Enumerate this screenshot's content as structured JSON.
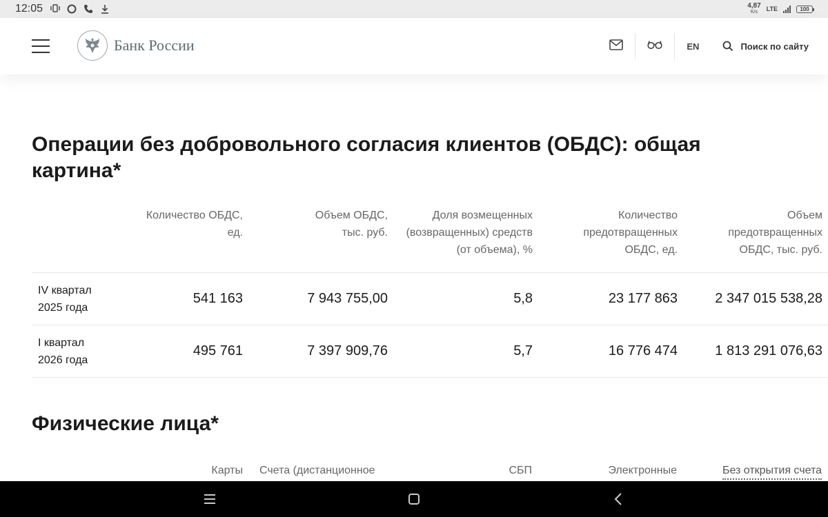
{
  "status_bar": {
    "time": "12:05",
    "net_speed": "4,87",
    "net_unit": "K/s",
    "network": "LTE",
    "battery": "100",
    "icons": [
      "vibrate-icon",
      "chat-icon",
      "call-icon",
      "download-icon",
      "signal-icon",
      "battery-icon"
    ]
  },
  "header": {
    "logo_name": "Банк России",
    "lang": "EN",
    "search_label": "Поиск по сайту",
    "icons": [
      "menu-icon",
      "emblem-icon",
      "mail-icon",
      "glasses-icon",
      "search-icon"
    ]
  },
  "main": {
    "title": "Операции без добровольного согласия клиентов (ОБДС): общая картина*",
    "table": {
      "columns": [
        "",
        "Количество ОБДС, ед.",
        "Объем ОБДС, тыс. руб.",
        "Доля возмещенных (возвращенных) средств (от объема), %",
        "Количество предотвращенных ОБДС, ед.",
        "Объем предотвращенных ОБДС, тыс. руб."
      ],
      "rows": [
        {
          "label": "IV квартал 2025 года",
          "values": [
            "541 163",
            "7 943 755,00",
            "5,8",
            "23 177 863",
            "2 347 015 538,28"
          ]
        },
        {
          "label": "I квартал 2026 года",
          "values": [
            "495 761",
            "7 397 909,76",
            "5,7",
            "16 776 474",
            "1 813 291 076,63"
          ]
        }
      ]
    },
    "section2_title": "Физические лица*",
    "section2_columns": [
      "Карты",
      "Счета (дистанционное",
      "СБП",
      "Электронные",
      "Без открытия счета"
    ]
  },
  "colors": {
    "status_bar_bg": "#ececec",
    "nav_bar_bg": "#000000",
    "text": "#1b1b1b",
    "muted": "#666666",
    "logo_text": "#5e6a74"
  }
}
